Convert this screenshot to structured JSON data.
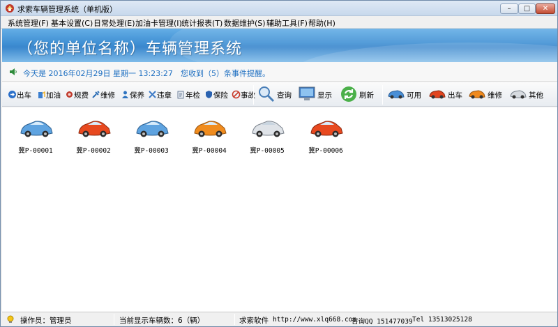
{
  "window": {
    "title": "求索车辆管理系统（单机版）",
    "controls": {
      "minimize": "–",
      "maximize": "□",
      "close": "✕"
    }
  },
  "menu": [
    "系统管理(F)",
    "基本设置(C)",
    "日常处理(E)",
    "加油卡管理(I)",
    "统计报表(T)",
    "数据维护(S)",
    "辅助工具(F)",
    "帮助(H)"
  ],
  "banner": {
    "title": "（您的单位名称）车辆管理系统"
  },
  "info": {
    "today": "今天是 2016年02月29日 星期一 13:23:27",
    "events": "您收到（5）条事件提醒。"
  },
  "toolbar": {
    "small": [
      {
        "label": "出车",
        "icon": "dispatch-icon",
        "color": "#2a6fc9"
      },
      {
        "label": "加油",
        "icon": "fuel-icon",
        "color": "#3b7fd0"
      },
      {
        "label": "规费",
        "icon": "fee-icon",
        "color": "#c0392b"
      },
      {
        "label": "维修",
        "icon": "repair-icon",
        "color": "#2b6db5"
      },
      {
        "label": "保养",
        "icon": "maintain-icon",
        "color": "#2f74c0"
      },
      {
        "label": "违章",
        "icon": "violation-icon",
        "color": "#3a78c5"
      },
      {
        "label": "年检",
        "icon": "inspection-icon",
        "color": "#6d7f99"
      },
      {
        "label": "保险",
        "icon": "insurance-icon",
        "color": "#2a62b0"
      },
      {
        "label": "事故",
        "icon": "accident-icon",
        "color": "#c83a2a"
      }
    ],
    "large": [
      {
        "label": "查询",
        "icon": "search-icon"
      },
      {
        "label": "显示",
        "icon": "monitor-icon"
      },
      {
        "label": "刷新",
        "icon": "refresh-icon"
      }
    ],
    "status_filters": [
      {
        "label": "可用",
        "icon": "car-available-icon",
        "color": "#4a8fd6"
      },
      {
        "label": "出车",
        "icon": "car-out-icon",
        "color": "#e2441e"
      },
      {
        "label": "维修",
        "icon": "car-repair-icon",
        "color": "#f08a1e"
      },
      {
        "label": "其他",
        "icon": "car-other-icon",
        "color": "#d7dbe0"
      }
    ]
  },
  "vehicles": [
    {
      "plate": "冀P-00001",
      "color": "#5ea3e0"
    },
    {
      "plate": "冀P-00002",
      "color": "#e8491f"
    },
    {
      "plate": "冀P-00003",
      "color": "#5ea3e0"
    },
    {
      "plate": "冀P-00004",
      "color": "#f08c1e"
    },
    {
      "plate": "冀P-00005",
      "color": "#dfe3e8"
    },
    {
      "plate": "冀P-00006",
      "color": "#e8491f"
    }
  ],
  "status": {
    "operator": "操作员：管理员",
    "count": "当前显示车辆数：6（辆）",
    "company": "求索软件",
    "url": "http://www.xlq668.com",
    "qq": "咨询QQ 151477039",
    "tel": "Tel 13513025128"
  }
}
